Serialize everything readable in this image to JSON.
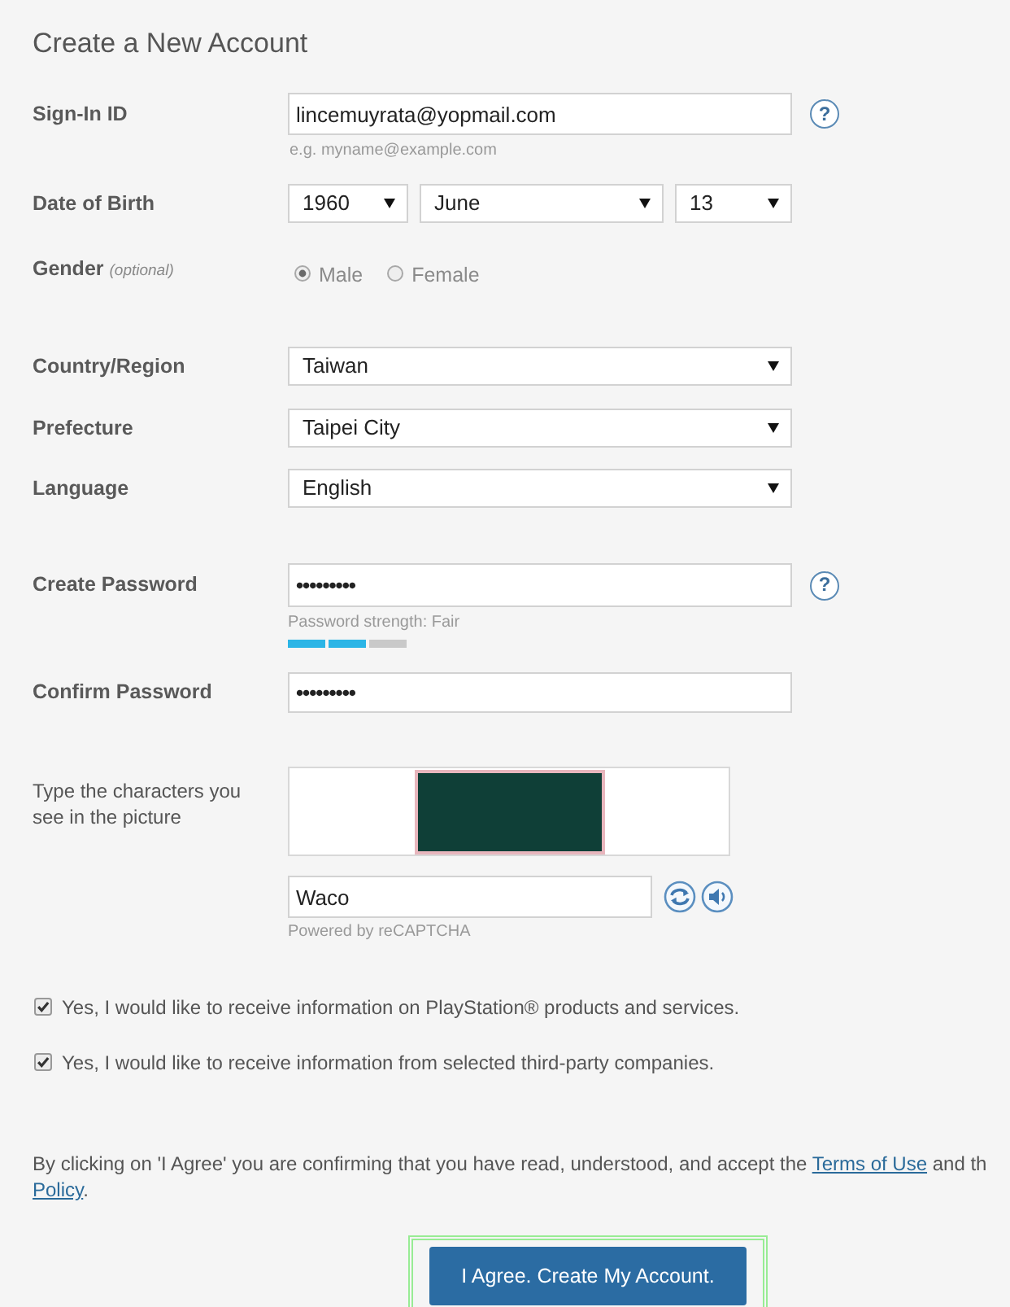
{
  "title": "Create a New Account",
  "sections": [
    {
      "rows": [
        {
          "kind": "text",
          "label": "Sign-In ID",
          "value": "lincemuyrata@yopmail.com",
          "help": "?",
          "hint": "e.g. myname@example.com"
        },
        {
          "kind": "date",
          "label": "Date of Birth",
          "selects": [
            {
              "value": "1960"
            },
            {
              "value": "June"
            },
            {
              "value": "13"
            }
          ]
        },
        {
          "kind": "radio",
          "label": "Gender *(optional)*",
          "options": [
            {
              "label": "Male",
              "selected": true
            },
            {
              "label": "Female",
              "selected": false
            }
          ]
        }
      ]
    },
    {
      "rows": [
        {
          "kind": "select",
          "label": "Country/Region",
          "value": "Taiwan"
        },
        {
          "kind": "select",
          "label": "Prefecture",
          "value": "Taipei City"
        },
        {
          "kind": "select",
          "label": "Language",
          "value": "English"
        }
      ]
    },
    {
      "rows": [
        {
          "kind": "password",
          "label": "Create Password",
          "value": "•••••••••",
          "help": "?",
          "strength": {
            "label": "Password strength: Fair",
            "segments": [
              {
                "on": true
              },
              {
                "on": true
              },
              {
                "on": false
              }
            ]
          }
        },
        {
          "kind": "password",
          "label": "Confirm Password",
          "value": "•••••••••"
        }
      ]
    },
    {
      "rows": [
        {
          "kind": "captcha",
          "label": "Type the characters you see in the picture",
          "value": "Waco",
          "footer": "Powered by reCAPTCHA"
        }
      ]
    }
  ],
  "consents": [
    {
      "label": "Yes, I would like to receive information on PlayStation® products and services.",
      "checked": true
    },
    {
      "label": "Yes, I would like to receive information from selected third-party companies.",
      "checked": true
    }
  ],
  "legal": {
    "lines": [
      [
        {
          "kind": "text",
          "text": "By clicking on 'I Agree' you are confirming that you have read, understood, and accept the "
        },
        {
          "kind": "link",
          "text": "Terms of Use"
        },
        {
          "kind": "text",
          "text": " and th"
        }
      ],
      [
        {
          "kind": "link",
          "text": "Policy"
        },
        {
          "kind": "text",
          "text": "."
        }
      ]
    ]
  },
  "submit": {
    "label": "I Agree. Create My Account.",
    "highlighted": true
  }
}
